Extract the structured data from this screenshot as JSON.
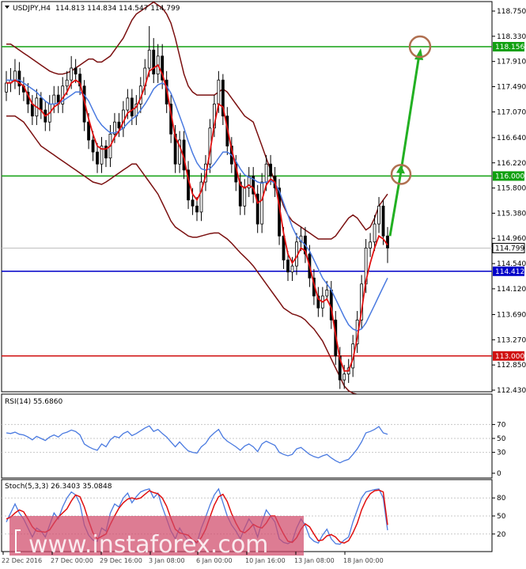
{
  "header": {
    "symbol": "USDJPY,H4",
    "ohlc": "114.813 114.834 114.547 114.799"
  },
  "watermark": "www.instaforex.com",
  "colors": {
    "candle": "#000000",
    "bollinger": "#7b1010",
    "ma_fast": "#e01010",
    "ma_slow": "#4a7ae0",
    "level_green": "#10a010",
    "level_blue": "#0000c8",
    "level_red": "#d01010",
    "arrow": "#22b022",
    "circle": "#b07050",
    "rsi_line": "#4a7ae0",
    "stoch_main": "#4a7ae0",
    "stoch_signal": "#e01010",
    "watermark_band": "#d04a6a"
  },
  "chart_data": [
    {
      "type": "candlestick",
      "title": "USDJPY,H4 114.813 114.834 114.547 114.799",
      "ylim": [
        112.3,
        118.9
      ],
      "y_ticks": [
        "118.750",
        "118.330",
        "117.910",
        "117.490",
        "117.070",
        "116.640",
        "116.220",
        "115.800",
        "115.380",
        "114.960",
        "114.540",
        "114.120",
        "113.690",
        "113.270",
        "112.850",
        "112.430"
      ],
      "x_ticks": [
        "22 Dec 2016",
        "27 Dec 00:00",
        "29 Dec 16:00",
        "3 Jan 08:00",
        "6 Jan 00:00",
        "10 Jan 16:00",
        "13 Jan 08:00",
        "18 Jan 00:00"
      ],
      "close": [
        117.55,
        117.6,
        117.75,
        117.5,
        117.4,
        117.2,
        117.0,
        117.3,
        117.1,
        116.9,
        117.2,
        117.35,
        117.2,
        117.5,
        117.6,
        117.8,
        117.7,
        117.5,
        116.9,
        116.6,
        116.4,
        116.2,
        116.5,
        116.3,
        116.7,
        116.9,
        116.8,
        117.1,
        117.3,
        117.0,
        117.2,
        117.5,
        117.8,
        118.1,
        117.7,
        118.0,
        117.6,
        117.2,
        116.7,
        116.2,
        116.6,
        116.1,
        115.6,
        115.5,
        115.4,
        115.9,
        116.2,
        116.8,
        117.2,
        117.6,
        117.0,
        116.5,
        116.2,
        115.9,
        115.5,
        115.8,
        116.0,
        115.7,
        115.2,
        115.9,
        116.2,
        116.0,
        115.8,
        115.0,
        114.6,
        114.4,
        114.5,
        114.9,
        115.0,
        114.7,
        114.3,
        114.0,
        113.8,
        114.0,
        114.1,
        113.6,
        113.0,
        112.6,
        112.7,
        112.8,
        113.2,
        113.6,
        114.2,
        114.8,
        114.9,
        115.2,
        115.5,
        115.0,
        114.8
      ],
      "open": [
        117.4,
        117.55,
        117.6,
        117.75,
        117.5,
        117.4,
        117.2,
        117.0,
        117.3,
        117.1,
        116.9,
        117.2,
        117.35,
        117.2,
        117.5,
        117.6,
        117.8,
        117.7,
        117.5,
        116.9,
        116.6,
        116.4,
        116.2,
        116.5,
        116.3,
        116.7,
        116.9,
        116.8,
        117.1,
        117.3,
        117.0,
        117.2,
        117.5,
        117.8,
        118.1,
        117.7,
        118.0,
        117.6,
        117.2,
        116.7,
        116.2,
        116.6,
        116.1,
        115.6,
        115.5,
        115.4,
        115.9,
        116.2,
        116.8,
        117.2,
        117.6,
        117.0,
        116.5,
        116.2,
        115.9,
        115.5,
        115.8,
        116.0,
        115.7,
        115.2,
        115.9,
        116.2,
        116.0,
        115.8,
        115.0,
        114.6,
        114.4,
        114.5,
        114.9,
        115.0,
        114.7,
        114.3,
        114.0,
        113.8,
        114.0,
        114.1,
        113.6,
        113.0,
        112.6,
        112.7,
        112.8,
        113.2,
        113.6,
        114.2,
        114.8,
        114.9,
        115.2,
        115.5,
        115.0
      ],
      "high": [
        117.75,
        117.8,
        117.95,
        117.9,
        117.65,
        117.55,
        117.35,
        117.45,
        117.4,
        117.25,
        117.35,
        117.5,
        117.5,
        117.65,
        117.75,
        118.0,
        117.95,
        117.8,
        117.6,
        117.05,
        116.75,
        116.55,
        116.65,
        116.6,
        116.85,
        117.05,
        117.05,
        117.25,
        117.45,
        117.45,
        117.35,
        117.65,
        117.95,
        118.5,
        118.3,
        118.2,
        118.2,
        117.75,
        117.35,
        116.85,
        116.75,
        116.75,
        116.25,
        115.8,
        115.65,
        116.05,
        116.35,
        116.95,
        117.35,
        117.75,
        117.7,
        117.15,
        116.65,
        116.35,
        116.05,
        115.95,
        116.15,
        116.15,
        115.85,
        116.05,
        116.35,
        116.35,
        116.15,
        115.95,
        115.15,
        114.75,
        114.65,
        115.05,
        115.15,
        115.15,
        114.85,
        114.45,
        114.15,
        114.15,
        114.25,
        114.25,
        113.75,
        113.15,
        112.85,
        112.95,
        113.35,
        113.75,
        114.35,
        114.95,
        115.05,
        115.35,
        115.65,
        115.6,
        115.15
      ],
      "low": [
        117.25,
        117.4,
        117.45,
        117.35,
        117.25,
        117.05,
        116.85,
        116.85,
        116.95,
        116.75,
        116.75,
        117.05,
        117.05,
        117.05,
        117.35,
        117.45,
        117.55,
        117.35,
        116.75,
        116.45,
        116.25,
        116.05,
        116.05,
        116.15,
        116.15,
        116.55,
        116.65,
        116.65,
        116.95,
        116.85,
        116.85,
        117.05,
        117.35,
        117.65,
        117.55,
        117.55,
        117.45,
        117.05,
        116.55,
        116.05,
        116.05,
        115.95,
        115.45,
        115.35,
        115.25,
        115.25,
        115.75,
        116.05,
        116.65,
        117.05,
        116.85,
        116.35,
        116.05,
        115.75,
        115.35,
        115.35,
        115.65,
        115.55,
        115.05,
        115.05,
        115.75,
        115.85,
        115.65,
        114.85,
        114.45,
        114.25,
        114.25,
        114.35,
        114.75,
        114.55,
        114.15,
        113.85,
        113.65,
        113.65,
        113.95,
        113.45,
        112.85,
        112.45,
        112.45,
        112.55,
        112.65,
        113.05,
        113.45,
        114.05,
        114.65,
        114.75,
        115.05,
        114.85,
        114.55
      ],
      "bollinger_upper": [
        118.2,
        118.2,
        118.15,
        118.1,
        118.05,
        118.0,
        117.95,
        117.9,
        117.85,
        117.8,
        117.75,
        117.72,
        117.7,
        117.7,
        117.72,
        117.75,
        117.8,
        117.85,
        117.9,
        117.95,
        117.95,
        117.9,
        117.9,
        117.95,
        118.0,
        118.1,
        118.2,
        118.3,
        118.45,
        118.6,
        118.7,
        118.75,
        118.8,
        118.85,
        118.9,
        118.85,
        118.8,
        118.7,
        118.55,
        118.3,
        118.0,
        117.7,
        117.5,
        117.4,
        117.35,
        117.35,
        117.35,
        117.35,
        117.35,
        117.4,
        117.45,
        117.4,
        117.3,
        117.2,
        117.1,
        117.0,
        116.95,
        116.9,
        116.7,
        116.5,
        116.3,
        116.1,
        115.9,
        115.7,
        115.5,
        115.35,
        115.25,
        115.2,
        115.15,
        115.1,
        115.05,
        115.0,
        114.95,
        114.95,
        114.95,
        114.95,
        115.0,
        115.1,
        115.2,
        115.3,
        115.35,
        115.3,
        115.2,
        115.1,
        115.15,
        115.3,
        115.5,
        115.6,
        115.7
      ],
      "bollinger_lower": [
        117.0,
        117.0,
        117.0,
        116.95,
        116.9,
        116.8,
        116.7,
        116.6,
        116.5,
        116.45,
        116.4,
        116.35,
        116.3,
        116.25,
        116.2,
        116.15,
        116.1,
        116.05,
        116.0,
        115.95,
        115.9,
        115.88,
        115.86,
        115.9,
        115.95,
        116.0,
        116.05,
        116.1,
        116.15,
        116.2,
        116.2,
        116.1,
        116.0,
        115.9,
        115.8,
        115.7,
        115.55,
        115.4,
        115.25,
        115.15,
        115.1,
        115.05,
        115.0,
        114.98,
        114.98,
        115.0,
        115.02,
        115.04,
        115.05,
        115.05,
        115.0,
        114.95,
        114.88,
        114.8,
        114.72,
        114.65,
        114.58,
        114.5,
        114.4,
        114.3,
        114.2,
        114.1,
        114.0,
        113.9,
        113.8,
        113.75,
        113.7,
        113.68,
        113.65,
        113.6,
        113.52,
        113.45,
        113.35,
        113.25,
        113.1,
        112.95,
        112.8,
        112.65,
        112.5,
        112.42,
        112.38,
        112.36,
        112.34,
        112.33,
        112.32,
        112.32,
        112.33,
        112.34,
        112.35
      ],
      "ma_fast": [
        117.55,
        117.55,
        117.6,
        117.55,
        117.5,
        117.35,
        117.2,
        117.15,
        117.1,
        117.0,
        117.05,
        117.15,
        117.2,
        117.3,
        117.4,
        117.55,
        117.6,
        117.55,
        117.25,
        116.95,
        116.7,
        116.5,
        116.45,
        116.45,
        116.5,
        116.65,
        116.75,
        116.9,
        117.05,
        117.1,
        117.15,
        117.3,
        117.5,
        117.75,
        117.8,
        117.85,
        117.7,
        117.45,
        117.05,
        116.65,
        116.5,
        116.3,
        115.95,
        115.7,
        115.6,
        115.75,
        116.0,
        116.4,
        116.85,
        117.2,
        117.15,
        116.8,
        116.45,
        116.15,
        115.85,
        115.8,
        115.85,
        115.8,
        115.55,
        115.6,
        115.85,
        115.95,
        115.9,
        115.5,
        115.05,
        114.7,
        114.55,
        114.65,
        114.8,
        114.75,
        114.5,
        114.2,
        113.95,
        113.9,
        113.95,
        113.8,
        113.35,
        112.95,
        112.75,
        112.75,
        112.95,
        113.3,
        113.75,
        114.25,
        114.55,
        114.8,
        115.0,
        114.95,
        114.85
      ],
      "ma_slow": [
        117.6,
        117.6,
        117.6,
        117.6,
        117.55,
        117.5,
        117.45,
        117.4,
        117.32,
        117.25,
        117.2,
        117.2,
        117.22,
        117.25,
        117.3,
        117.35,
        117.4,
        117.4,
        117.35,
        117.25,
        117.1,
        116.95,
        116.85,
        116.78,
        116.72,
        116.72,
        116.75,
        116.8,
        116.88,
        116.95,
        117.0,
        117.1,
        117.2,
        117.32,
        117.45,
        117.52,
        117.55,
        117.5,
        117.38,
        117.2,
        117.0,
        116.8,
        116.58,
        116.38,
        116.22,
        116.12,
        116.1,
        116.12,
        116.2,
        116.3,
        116.4,
        116.4,
        116.35,
        116.25,
        116.12,
        116.02,
        115.98,
        115.95,
        115.9,
        115.88,
        115.9,
        115.92,
        115.88,
        115.75,
        115.55,
        115.35,
        115.15,
        115.0,
        114.92,
        114.85,
        114.75,
        114.6,
        114.45,
        114.3,
        114.2,
        114.1,
        113.95,
        113.8,
        113.65,
        113.52,
        113.45,
        113.42,
        113.45,
        113.55,
        113.7,
        113.85,
        114.0,
        114.15,
        114.3
      ],
      "levels": [
        118.156,
        116.0,
        114.412,
        113.0
      ],
      "level_labels": [
        "118.156",
        "116.000",
        "114.412",
        "113.000"
      ],
      "current_price": "114.799",
      "arrow_points": [
        [
          115.0,
          116.0
        ],
        [
          118.156,
          118.156
        ]
      ]
    },
    {
      "type": "line",
      "title": "RSI(14) 55.6860",
      "ylim": [
        0,
        100
      ],
      "y_ticks": [
        "70",
        "50",
        "30",
        "0"
      ],
      "values": [
        58,
        57,
        59,
        56,
        55,
        52,
        48,
        53,
        50,
        47,
        52,
        55,
        52,
        57,
        59,
        62,
        60,
        55,
        42,
        38,
        35,
        33,
        42,
        38,
        48,
        53,
        51,
        57,
        60,
        54,
        57,
        61,
        65,
        68,
        60,
        63,
        57,
        52,
        45,
        38,
        45,
        38,
        32,
        30,
        29,
        38,
        43,
        52,
        58,
        63,
        52,
        46,
        42,
        38,
        33,
        39,
        42,
        38,
        31,
        42,
        46,
        43,
        40,
        30,
        27,
        25,
        27,
        35,
        37,
        32,
        27,
        24,
        22,
        25,
        27,
        22,
        18,
        15,
        18,
        20,
        27,
        35,
        45,
        58,
        60,
        63,
        67,
        58,
        56
      ]
    },
    {
      "type": "line",
      "title": "Stoch(5,3,3) 26.3403 35.0848",
      "ylim": [
        0,
        100
      ],
      "y_ticks": [
        "80",
        "50",
        "20"
      ],
      "main": [
        40,
        55,
        70,
        55,
        45,
        30,
        15,
        30,
        25,
        15,
        35,
        55,
        45,
        65,
        80,
        90,
        85,
        70,
        35,
        18,
        10,
        8,
        30,
        25,
        55,
        70,
        65,
        80,
        88,
        72,
        82,
        90,
        93,
        95,
        80,
        88,
        65,
        45,
        25,
        12,
        30,
        18,
        8,
        6,
        5,
        30,
        48,
        68,
        85,
        95,
        72,
        50,
        35,
        25,
        12,
        30,
        45,
        35,
        15,
        40,
        60,
        50,
        40,
        12,
        6,
        4,
        8,
        30,
        45,
        35,
        15,
        8,
        5,
        18,
        28,
        12,
        4,
        3,
        10,
        15,
        40,
        60,
        80,
        90,
        92,
        94,
        95,
        80,
        26.34
      ],
      "signal": [
        45,
        48,
        55,
        60,
        57,
        45,
        32,
        25,
        24,
        23,
        27,
        38,
        48,
        55,
        62,
        75,
        85,
        82,
        65,
        42,
        22,
        12,
        16,
        20,
        36,
        50,
        63,
        72,
        78,
        80,
        78,
        80,
        86,
        92,
        89,
        87,
        80,
        66,
        46,
        28,
        22,
        20,
        18,
        10,
        6,
        14,
        28,
        48,
        68,
        82,
        86,
        74,
        54,
        38,
        25,
        22,
        28,
        36,
        32,
        30,
        38,
        50,
        50,
        34,
        20,
        8,
        6,
        14,
        28,
        37,
        32,
        20,
        9,
        10,
        17,
        19,
        15,
        7,
        5,
        9,
        22,
        38,
        60,
        76,
        87,
        92,
        93,
        90,
        35.08
      ]
    }
  ]
}
